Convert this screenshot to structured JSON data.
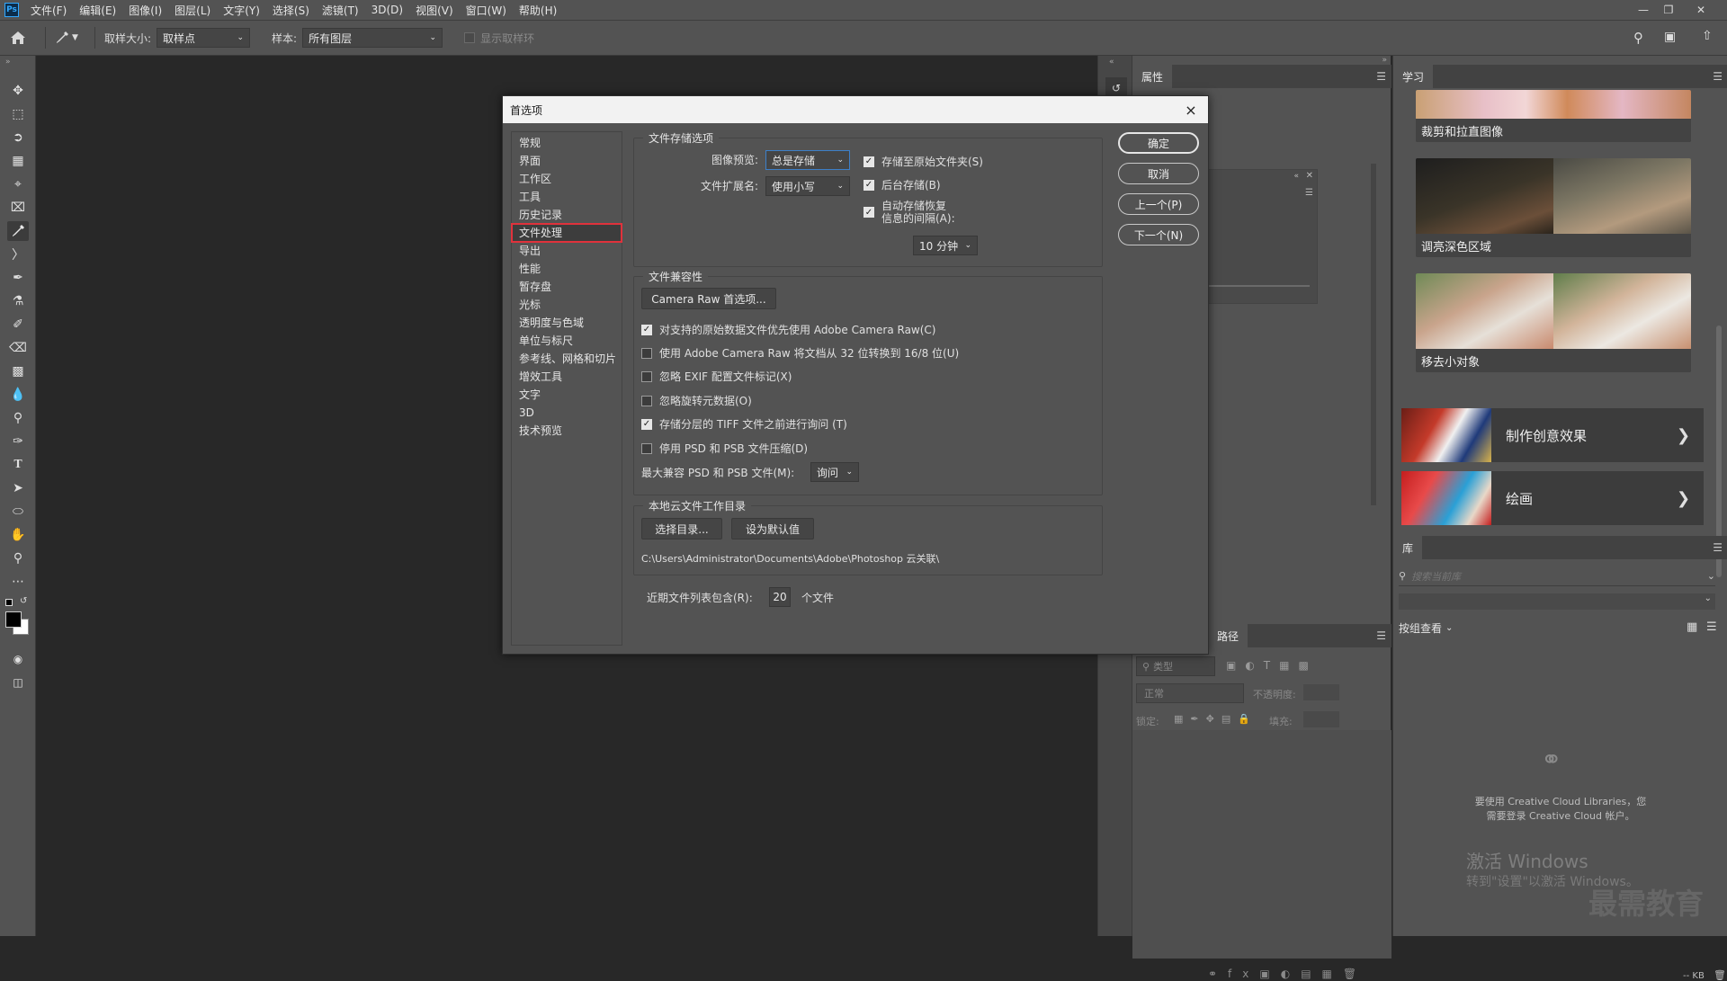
{
  "app": {
    "logo": "Ps"
  },
  "menubar": {
    "items": [
      "文件(F)",
      "编辑(E)",
      "图像(I)",
      "图层(L)",
      "文字(Y)",
      "选择(S)",
      "滤镜(T)",
      "3D(D)",
      "视图(V)",
      "窗口(W)",
      "帮助(H)"
    ]
  },
  "options_bar": {
    "sample_size_label": "取样大小:",
    "sample_size_value": "取样点",
    "sample_label": "样本:",
    "sample_value": "所有图层",
    "show_ring_label": "显示取样环"
  },
  "dialog": {
    "title": "首选项",
    "categories": [
      "常规",
      "界面",
      "工作区",
      "工具",
      "历史记录",
      "文件处理",
      "导出",
      "性能",
      "暂存盘",
      "光标",
      "透明度与色域",
      "单位与标尺",
      "参考线、网格和切片",
      "增效工具",
      "文字",
      "3D",
      "技术预览"
    ],
    "selected_category": "文件处理",
    "file_saving": {
      "group_label": "文件存储选项",
      "image_preview_label": "图像预览:",
      "image_preview_value": "总是存储",
      "file_ext_label": "文件扩展名:",
      "file_ext_value": "使用小写",
      "save_to_original": "存储至原始文件夹(S)",
      "background_save": "后台存储(B)",
      "auto_save_line1": "自动存储恢复",
      "auto_save_line2": "信息的间隔(A):",
      "interval_value": "10 分钟"
    },
    "compat": {
      "group_label": "文件兼容性",
      "camera_raw_button": "Camera Raw 首选项...",
      "opt1": "对支持的原始数据文件优先使用 Adobe Camera Raw(C)",
      "opt2": "使用 Adobe Camera Raw 将文档从 32 位转换到 16/8 位(U)",
      "opt3": "忽略 EXIF 配置文件标记(X)",
      "opt4": "忽略旋转元数据(O)",
      "opt5": "存储分层的 TIFF 文件之前进行询问 (T)",
      "opt6": "停用 PSD 和 PSB 文件压缩(D)",
      "max_compat_label": "最大兼容 PSD 和 PSB 文件(M):",
      "max_compat_value": "询问"
    },
    "cloud": {
      "group_label": "本地云文件工作目录",
      "choose_button": "选择目录...",
      "default_button": "设为默认值",
      "path": "C:\\Users\\Administrator\\Documents\\Adobe\\Photoshop 云关联\\"
    },
    "recent": {
      "label": "近期文件列表包含(R):",
      "value": "20",
      "suffix": "个文件"
    },
    "buttons": {
      "ok": "确定",
      "cancel": "取消",
      "prev": "上一个(P)",
      "next": "下一个(N)"
    },
    "close_icon": "×"
  },
  "panels": {
    "properties_tab": "属性",
    "paths_tab": "路径",
    "learn_tab": "学习",
    "library_tab": "库",
    "layers": {
      "kind_label": "类型",
      "blend_mode": "正常",
      "opacity_label": "不透明度:",
      "lock_label": "锁定:",
      "fill_label": "填充:"
    },
    "learn_cards": [
      "裁剪和拉直图像",
      "调亮深色区域",
      "移去小对象"
    ],
    "learn_big": [
      "制作创意效果",
      "绘画"
    ],
    "library": {
      "search_placeholder": "搜索当前库",
      "group_view": "按组查看",
      "cc_message_line1": "要使用 Creative Cloud Libraries，您",
      "cc_message_line2": "需要登录 Creative Cloud 帐户。",
      "size": "-- KB"
    }
  },
  "watermark": {
    "activate_line1": "激活 Windows",
    "activate_line2": "转到\"设置\"以激活 Windows。",
    "brand": "最需教育"
  },
  "colors": {
    "highlight_box": "#e0323c",
    "ui_bg": "#535353",
    "canvas": "#282828",
    "dialog_title_bg": "#f2f2f2"
  }
}
